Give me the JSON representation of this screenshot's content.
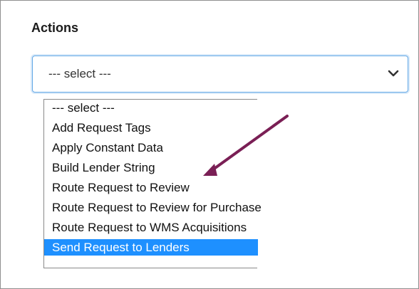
{
  "section": {
    "title": "Actions"
  },
  "select": {
    "value": "--- select ---",
    "icon": "chevron-down-icon"
  },
  "dropdown": {
    "options": [
      {
        "label": "--- select ---"
      },
      {
        "label": "Add Request Tags"
      },
      {
        "label": "Apply Constant Data"
      },
      {
        "label": "Build Lender String"
      },
      {
        "label": "Route Request to Review"
      },
      {
        "label": "Route Request to Review for Purchase"
      },
      {
        "label": "Route Request to WMS Acquisitions"
      },
      {
        "label": "Send Request to Lenders"
      }
    ],
    "highlighted_option": "Send Request to Lenders"
  },
  "colors": {
    "highlight": "#1e90ff",
    "focus_border": "#64a9e6",
    "annotation_arrow": "#7a1f55"
  }
}
